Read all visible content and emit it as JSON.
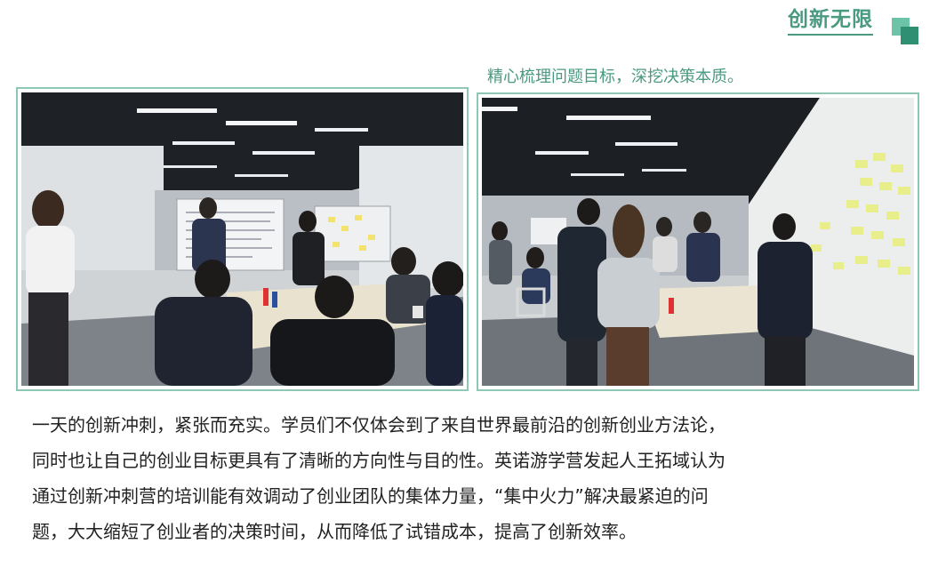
{
  "header": {
    "title": "创新无限"
  },
  "caption": "精心梳理问题目标，深挖决策本质。",
  "photos": [
    {
      "alt": "workshop-photo-1"
    },
    {
      "alt": "workshop-photo-2"
    }
  ],
  "body": {
    "lines": [
      "一天的创新冲刺，紧张而充实。学员们不仅体会到了来自世界最前沿的创新创业方法论，",
      "同时也让自己的创业目标更具有了清晰的方向性与目的性。英诺游学营发起人王拓域认为",
      "通过创新冲刺营的培训能有效调动了创业团队的集体力量，“集中火力”解决最紧迫的问",
      "题，大大缩短了创业者的决策时间，从而降低了试错成本，提高了创新效率。"
    ]
  },
  "colors": {
    "accent": "#4a9a82",
    "frame": "#8ec7b4",
    "text": "#222222"
  }
}
